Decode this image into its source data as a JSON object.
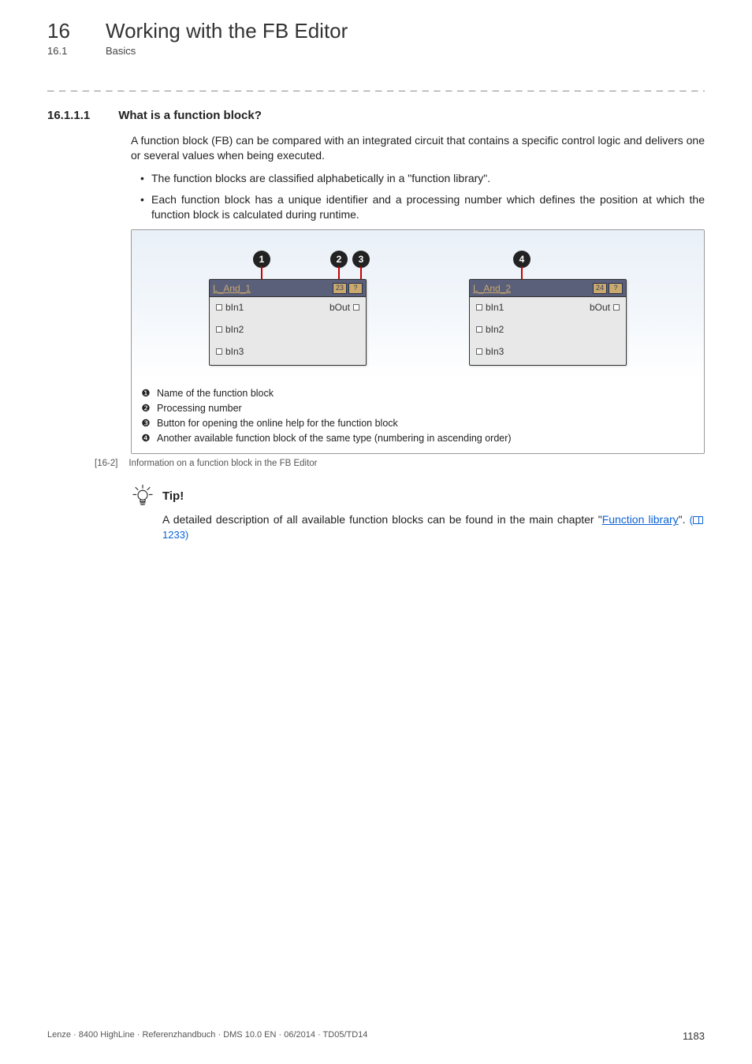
{
  "header": {
    "chapter_num": "16",
    "chapter_title": "Working with the FB Editor",
    "section_num": "16.1",
    "section_title": "Basics"
  },
  "dashline": "_ _ _ _ _ _ _ _ _ _ _ _ _ _ _ _ _ _ _ _ _ _ _ _ _ _ _ _ _ _ _ _ _ _ _ _ _ _ _ _ _ _ _ _ _ _ _ _ _ _ _ _ _ _ _ _ _ _ _ _ _ _ _ _",
  "subhead": {
    "num": "16.1.1.1",
    "title": "What is a function block?"
  },
  "para1": "A function block (FB) can be compared with an integrated circuit that contains a specific control logic and delivers one or several values when being executed.",
  "bullets": [
    "The function blocks are classified alphabetically in a \"function library\".",
    "Each function block has a unique identifier and a processing number which defines the position at which the function block is calculated during runtime."
  ],
  "callout_txt": {
    "c1": "1",
    "c2": "2",
    "c3": "3",
    "c4": "4"
  },
  "fb1": {
    "title": "L_And_1",
    "proc": "23",
    "help": "?",
    "in1": "bIn1",
    "in2": "bIn2",
    "in3": "bIn3",
    "out": "bOut"
  },
  "fb2": {
    "title": "L_And_2",
    "proc": "24",
    "help": "?",
    "in1": "bIn1",
    "in2": "bIn2",
    "in3": "bIn3",
    "out": "bOut"
  },
  "legend": {
    "s1": "❶",
    "t1": "Name of the function block",
    "s2": "❷",
    "t2": "Processing number",
    "s3": "❸",
    "t3": "Button for opening the online help for the function block",
    "s4": "❹",
    "t4": "Another available function block of the same type (numbering in ascending order)"
  },
  "caption": {
    "label": "[16-2]",
    "text": "Information on a function block in the FB Editor"
  },
  "tip": {
    "label": "Tip!",
    "body_pre": "A detailed description of all available function blocks can be found in the main chapter \"",
    "link": "Function library",
    "body_post": "\". ",
    "pageref": "1233)"
  },
  "footer": {
    "left": "Lenze · 8400 HighLine · Referenzhandbuch · DMS 10.0 EN · 06/2014 · TD05/TD14",
    "page": "1183"
  }
}
